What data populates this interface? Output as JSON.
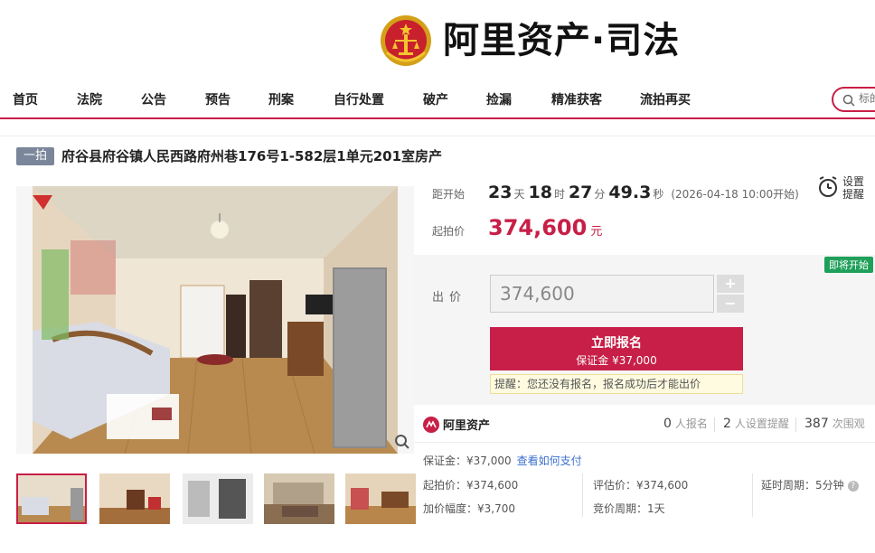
{
  "header": {
    "logo_text": "阿里资产·司法"
  },
  "nav": {
    "items": [
      "首页",
      "法院",
      "公告",
      "预告",
      "刑案",
      "自行处置",
      "破产",
      "捡漏",
      "精准获客",
      "流拍再买"
    ],
    "search_placeholder": "标的"
  },
  "listing": {
    "badge": "一拍",
    "title": "府谷县府谷镇人民西路府州巷176号1-582层1单元201室房产"
  },
  "countdown": {
    "label": "距开始",
    "days": "23",
    "days_unit": "天",
    "hours": "18",
    "hours_unit": "时",
    "minutes": "27",
    "minutes_unit": "分",
    "seconds": "49.3",
    "seconds_unit": "秒",
    "note": "(2026-04-18 10:00开始)"
  },
  "start_price": {
    "label": "起拍价",
    "value": "374,600",
    "unit": "元"
  },
  "remind": {
    "label": "设置提醒"
  },
  "bid": {
    "status_tag": "即将开始",
    "label": "出价",
    "value": "374,600",
    "plus": "+",
    "minus": "−",
    "signup_label": "立即报名",
    "deposit_label": "保证金 ¥37,000",
    "notice": "提醒：您还没有报名，报名成功后才能出价"
  },
  "stats": {
    "brand": "阿里资产",
    "signups": "0",
    "signups_label": "人报名",
    "reminders": "2",
    "reminders_label": "人设置提醒",
    "views": "387",
    "views_label": "次围观"
  },
  "details": {
    "deposit": "保证金：¥37,000",
    "how_to_pay": "查看如何支付",
    "start_price": "起拍价：¥374,600",
    "appraisal": "评估价：¥374,600",
    "delay": "延时周期：5分钟",
    "increment": "加价幅度：¥3,700",
    "cycle": "竞价周期：1天"
  },
  "colors": {
    "accent": "#c71f47",
    "tag_green": "#1fa05a",
    "link": "#3a6fcf"
  }
}
